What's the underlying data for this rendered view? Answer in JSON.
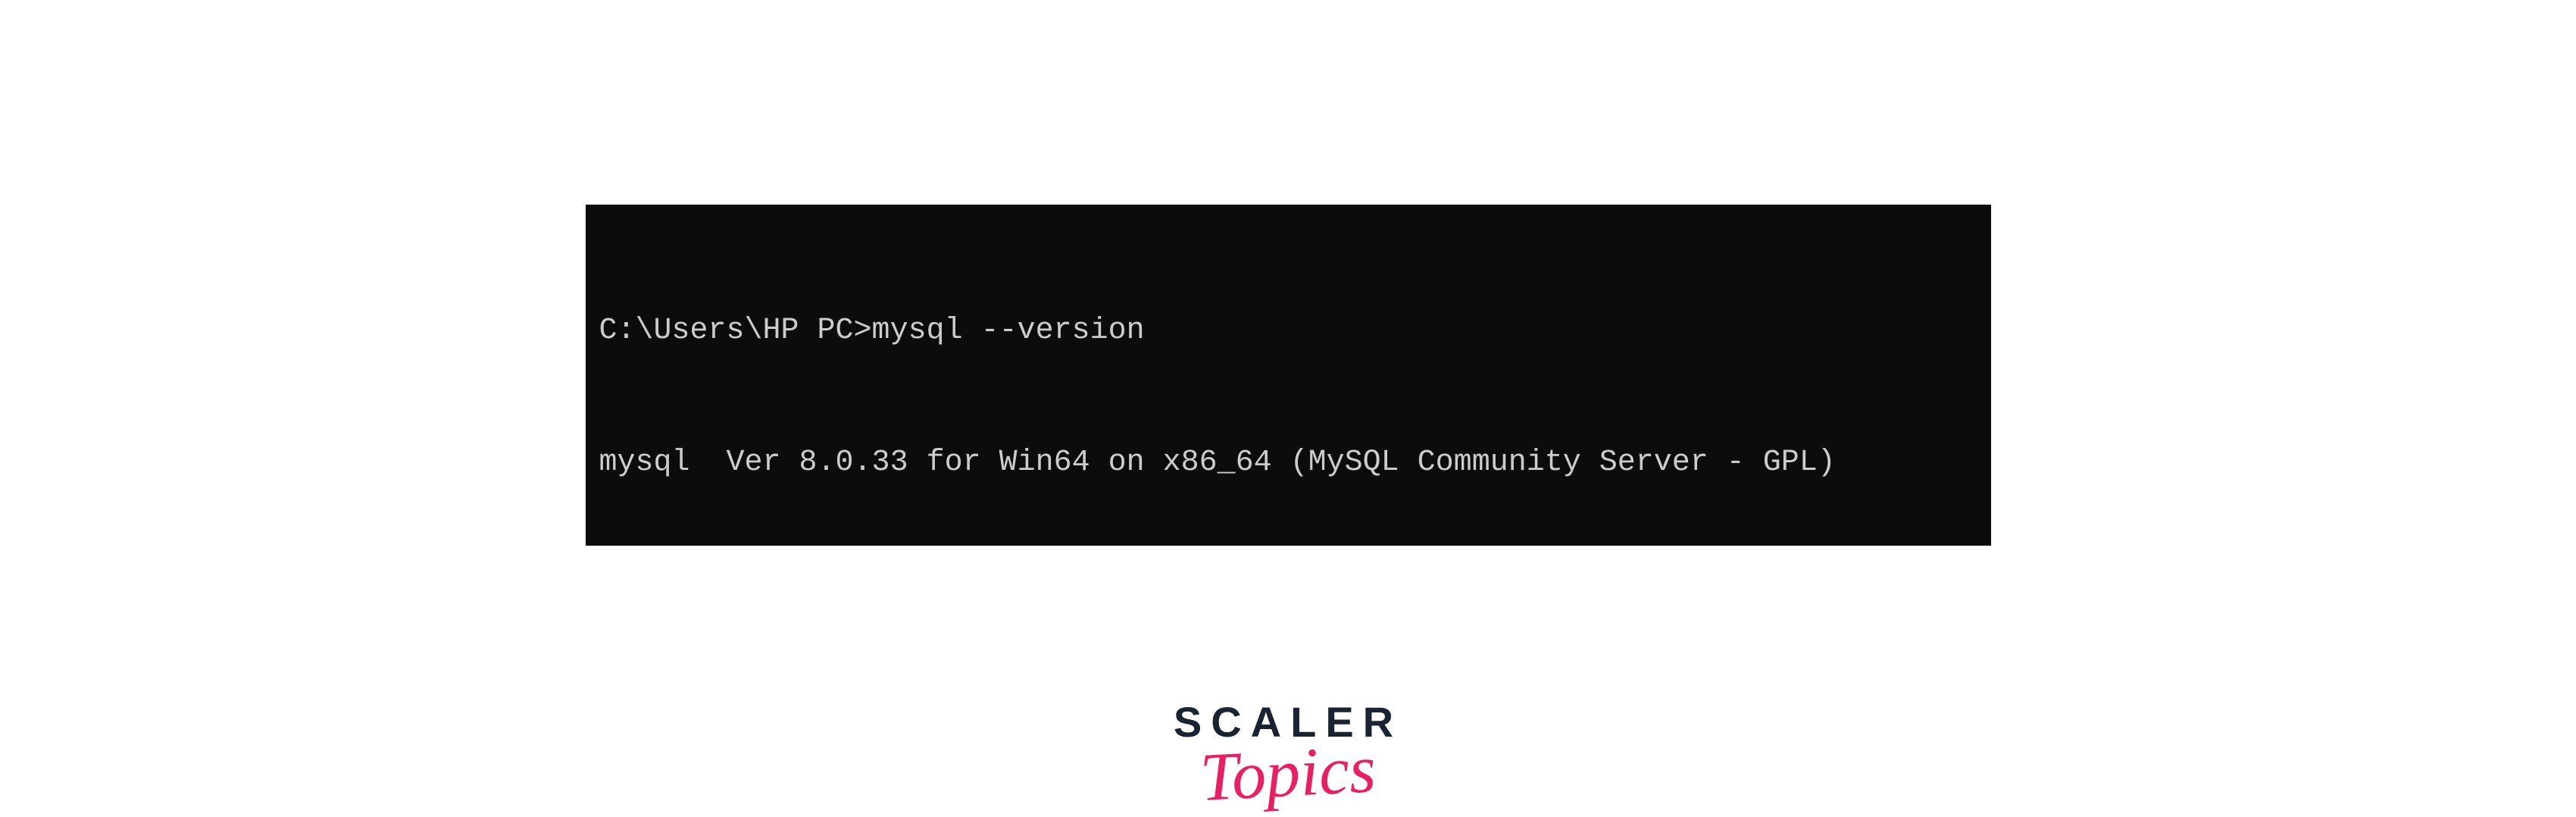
{
  "terminal": {
    "lines": [
      "C:\\Users\\HP PC>mysql --version",
      "mysql  Ver 8.0.33 for Win64 on x86_64 (MySQL Community Server - GPL)"
    ]
  },
  "logo": {
    "brand": "SCALER",
    "product": "Topics"
  },
  "colors": {
    "terminal_bg": "#0c0c0c",
    "terminal_text": "#cccccc",
    "logo_brand": "#1a2332",
    "logo_product": "#e91e63"
  }
}
